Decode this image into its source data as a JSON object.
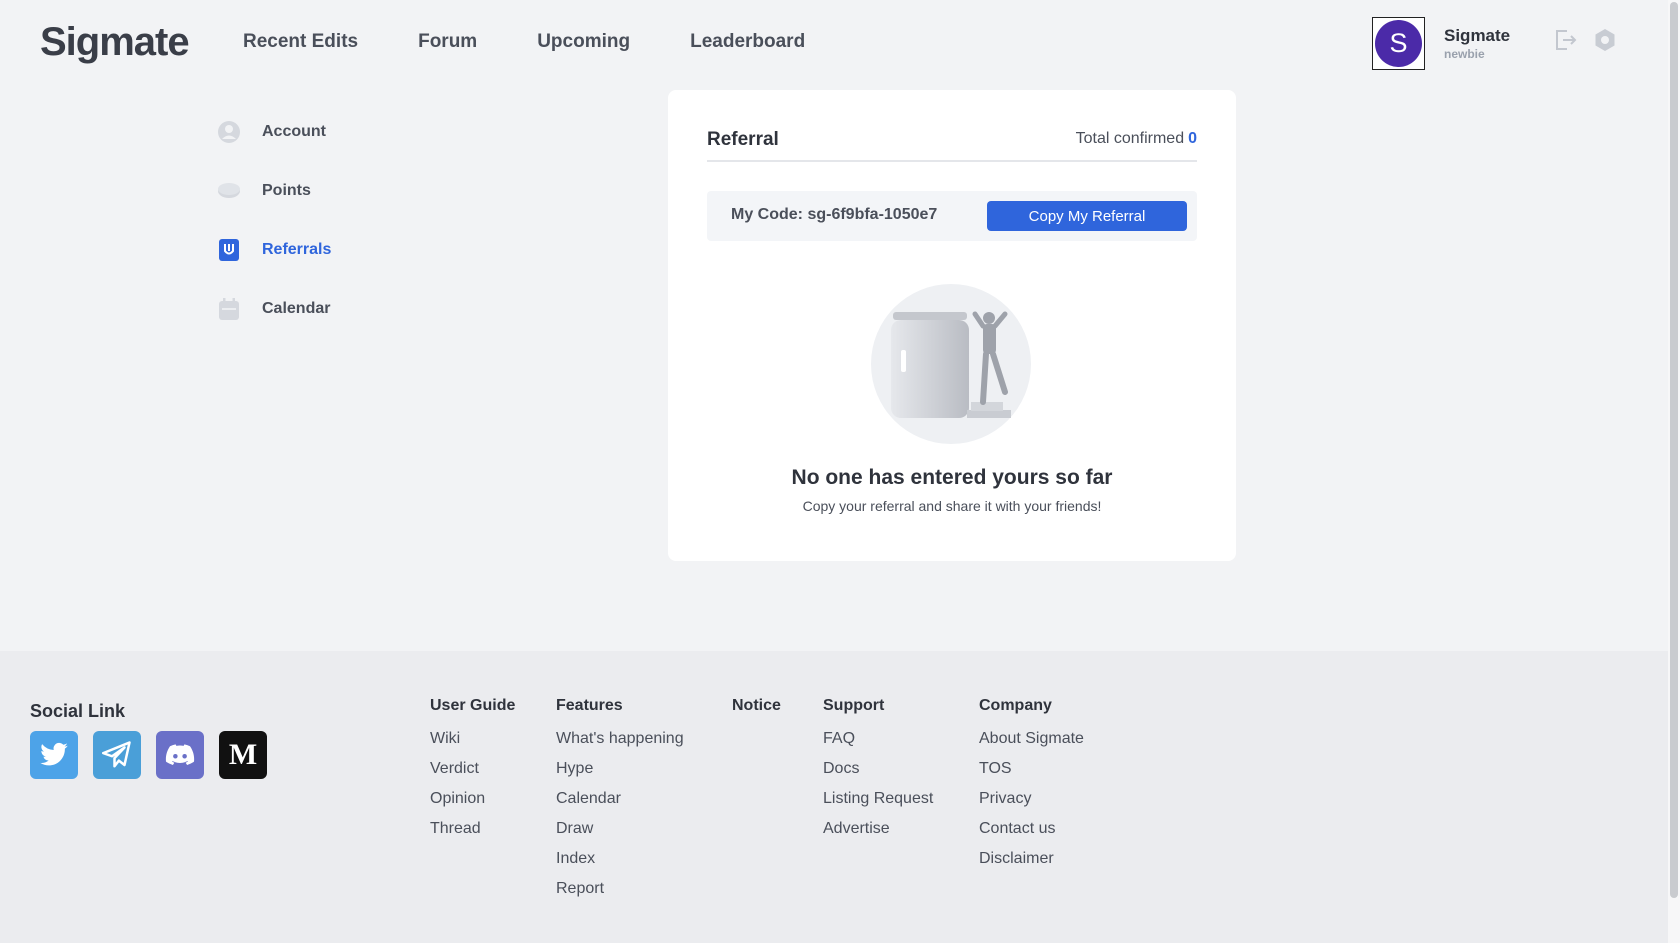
{
  "header": {
    "logo": "Sigmate",
    "nav": [
      "Recent Edits",
      "Forum",
      "Upcoming",
      "Leaderboard"
    ],
    "user": {
      "avatar_letter": "S",
      "name": "Sigmate",
      "role": "newbie"
    },
    "icons": {
      "logout": "logout-icon",
      "settings": "settings-icon"
    }
  },
  "sidebar": {
    "items": [
      {
        "label": "Account",
        "icon": "user-icon",
        "active": false
      },
      {
        "label": "Points",
        "icon": "coin-icon",
        "active": false
      },
      {
        "label": "Referrals",
        "icon": "referral-icon",
        "active": true
      },
      {
        "label": "Calendar",
        "icon": "calendar-icon",
        "active": false
      }
    ]
  },
  "referral": {
    "title": "Referral",
    "total_label": "Total confirmed",
    "total_count": "0",
    "code_text": "My Code: sg-6f9bfa-1050e7",
    "copy_button": "Copy My Referral",
    "empty_title": "No one has entered yours so far",
    "empty_subtitle": "Copy your referral and share it with your friends!"
  },
  "footer": {
    "social_title": "Social Link",
    "social": [
      {
        "name": "twitter-icon",
        "color": "#4da3e8"
      },
      {
        "name": "telegram-icon",
        "color": "#4a9fd8"
      },
      {
        "name": "discord-icon",
        "color": "#6a70c8"
      },
      {
        "name": "medium-icon",
        "color": "#111111"
      }
    ],
    "columns": [
      {
        "title": "User Guide",
        "links": [
          "Wiki",
          "Verdict",
          "Opinion",
          "Thread"
        ]
      },
      {
        "title": "Features",
        "links": [
          "What's happening",
          "Hype",
          "Calendar",
          "Draw",
          "Index",
          "Report"
        ]
      },
      {
        "title": "Notice",
        "links": []
      },
      {
        "title": "Support",
        "links": [
          "FAQ",
          "Docs",
          "Listing Request",
          "Advertise"
        ]
      },
      {
        "title": "Company",
        "links": [
          "About Sigmate",
          "TOS",
          "Privacy",
          "Contact us",
          "Disclaimer"
        ]
      }
    ]
  },
  "colors": {
    "accent": "#2f65dc",
    "avatar": "#4b2aa8",
    "page_bg": "#f2f3f5",
    "footer_bg": "#ebecef"
  }
}
